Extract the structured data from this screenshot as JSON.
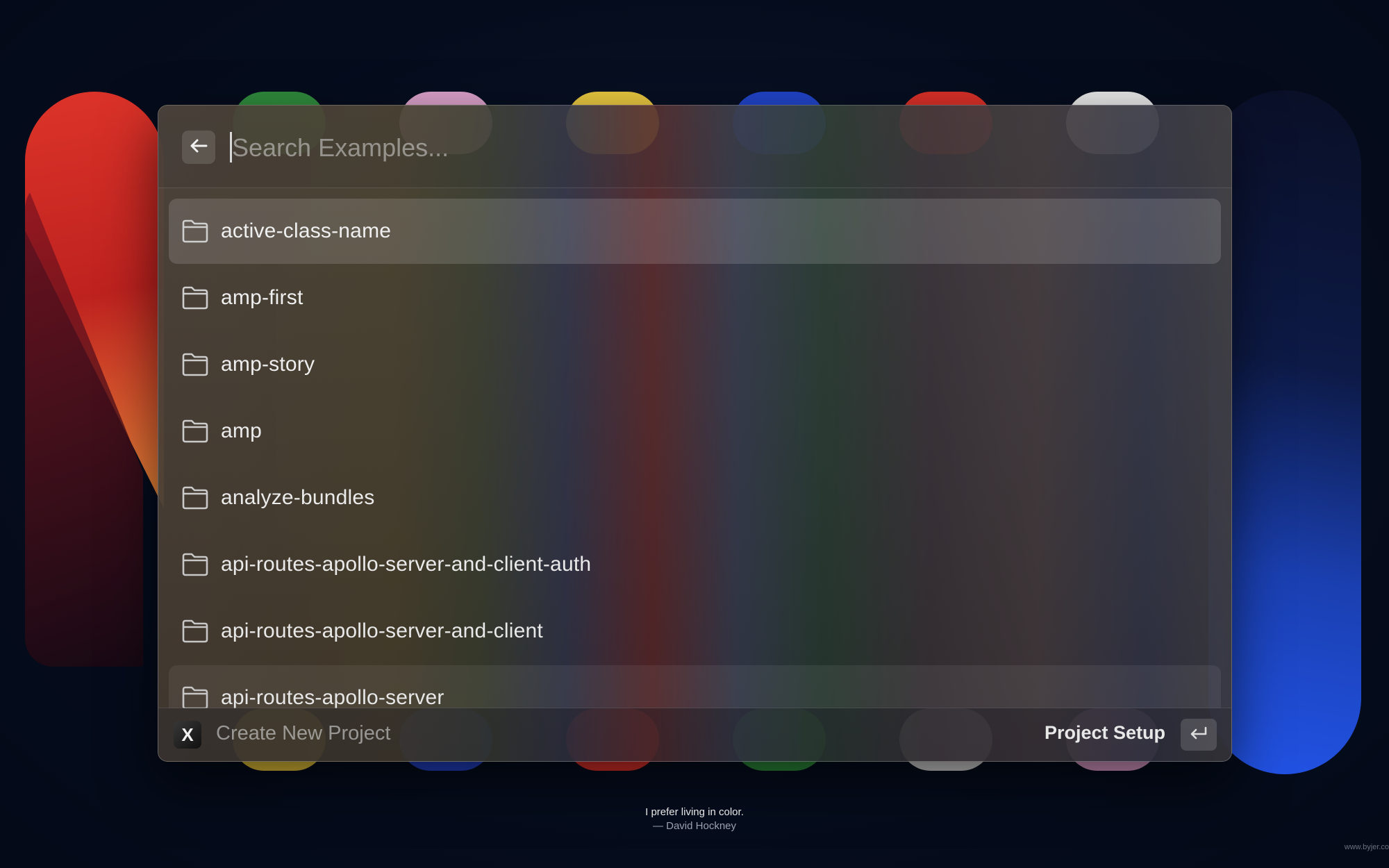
{
  "search": {
    "placeholder": "Search Examples...",
    "back_icon": "arrow-left-icon"
  },
  "items": [
    {
      "label": "active-class-name",
      "icon": "folder-icon",
      "state": "selected"
    },
    {
      "label": "amp-first",
      "icon": "folder-icon",
      "state": "normal"
    },
    {
      "label": "amp-story",
      "icon": "folder-icon",
      "state": "normal"
    },
    {
      "label": "amp",
      "icon": "folder-icon",
      "state": "normal"
    },
    {
      "label": "analyze-bundles",
      "icon": "folder-icon",
      "state": "normal"
    },
    {
      "label": "api-routes-apollo-server-and-client-auth",
      "icon": "folder-icon",
      "state": "normal"
    },
    {
      "label": "api-routes-apollo-server-and-client",
      "icon": "folder-icon",
      "state": "normal"
    },
    {
      "label": "api-routes-apollo-server",
      "icon": "folder-icon",
      "state": "hovered"
    }
  ],
  "footer": {
    "app_badge": "X",
    "create_label": "Create New Project",
    "action_label": "Project Setup",
    "enter_icon": "return-key-icon"
  },
  "wallpaper": {
    "quote": "I prefer living in color.",
    "author": "— David Hockney",
    "watermark": "www.byjer.co"
  },
  "colors": {
    "background": "#050d1f",
    "text": "#f2f2f2",
    "placeholder": "rgba(230,230,230,0.5)"
  }
}
